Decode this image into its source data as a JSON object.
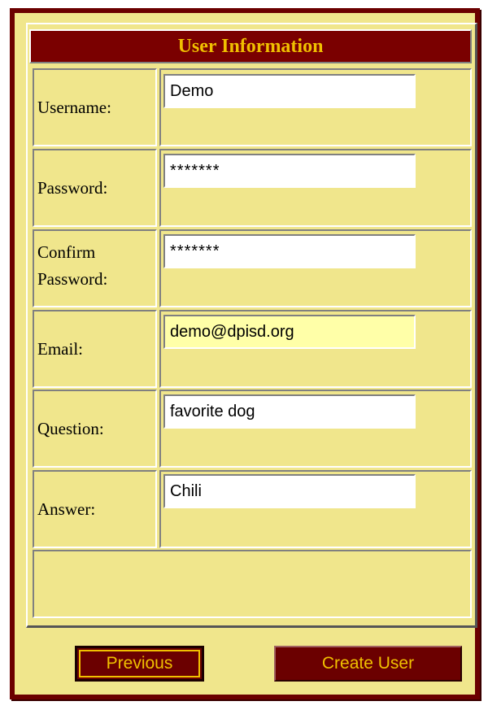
{
  "form": {
    "title": "User Information",
    "fields": [
      {
        "label": "Username:",
        "value": "Demo"
      },
      {
        "label": "Password:",
        "value": "*******"
      },
      {
        "label": "Confirm Password:",
        "value": "*******"
      },
      {
        "label": "Email:",
        "value": "demo@dpisd.org"
      },
      {
        "label": "Question:",
        "value": "favorite dog"
      },
      {
        "label": "Answer:",
        "value": "Chili"
      }
    ]
  },
  "buttons": {
    "previous": "Previous",
    "create": "Create User"
  },
  "colors": {
    "panel_background": "#F0E68C",
    "title_background": "#7A0000",
    "title_text": "#F0C000",
    "button_background": "#6B0000",
    "highlight_field": "#FFFFA8"
  }
}
